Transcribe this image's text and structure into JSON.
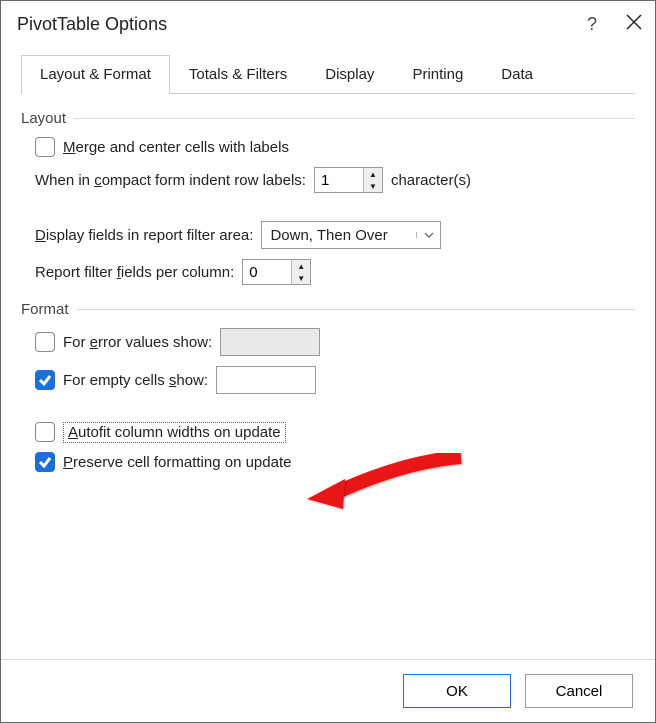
{
  "dialog": {
    "title": "PivotTable Options",
    "help_symbol": "?",
    "close_label": "Close"
  },
  "tabs": [
    "Layout & Format",
    "Totals & Filters",
    "Display",
    "Printing",
    "Data"
  ],
  "layout_group": {
    "title": "Layout",
    "merge_label_pre": "M",
    "merge_label_post": "erge and center cells with labels",
    "indent_label_pre": "When in ",
    "indent_label_u": "c",
    "indent_label_post": "ompact form indent row labels:",
    "indent_value": "1",
    "indent_suffix": "character(s)",
    "display_fields_u": "D",
    "display_fields_post": "isplay fields in report filter area:",
    "display_fields_value": "Down, Then Over",
    "filter_fields_pre": "Report filter ",
    "filter_fields_u": "f",
    "filter_fields_post": "ields per column:",
    "filter_fields_value": "0"
  },
  "format_group": {
    "title": "Format",
    "error_pre": "For ",
    "error_u": "e",
    "error_post": "rror values show:",
    "empty_pre": "For empty cells ",
    "empty_u": "s",
    "empty_post": "how:",
    "autofit_u": "A",
    "autofit_post": "utofit column widths on update",
    "preserve_u": "P",
    "preserve_post": "reserve cell formatting on update"
  },
  "footer": {
    "ok": "OK",
    "cancel": "Cancel"
  }
}
